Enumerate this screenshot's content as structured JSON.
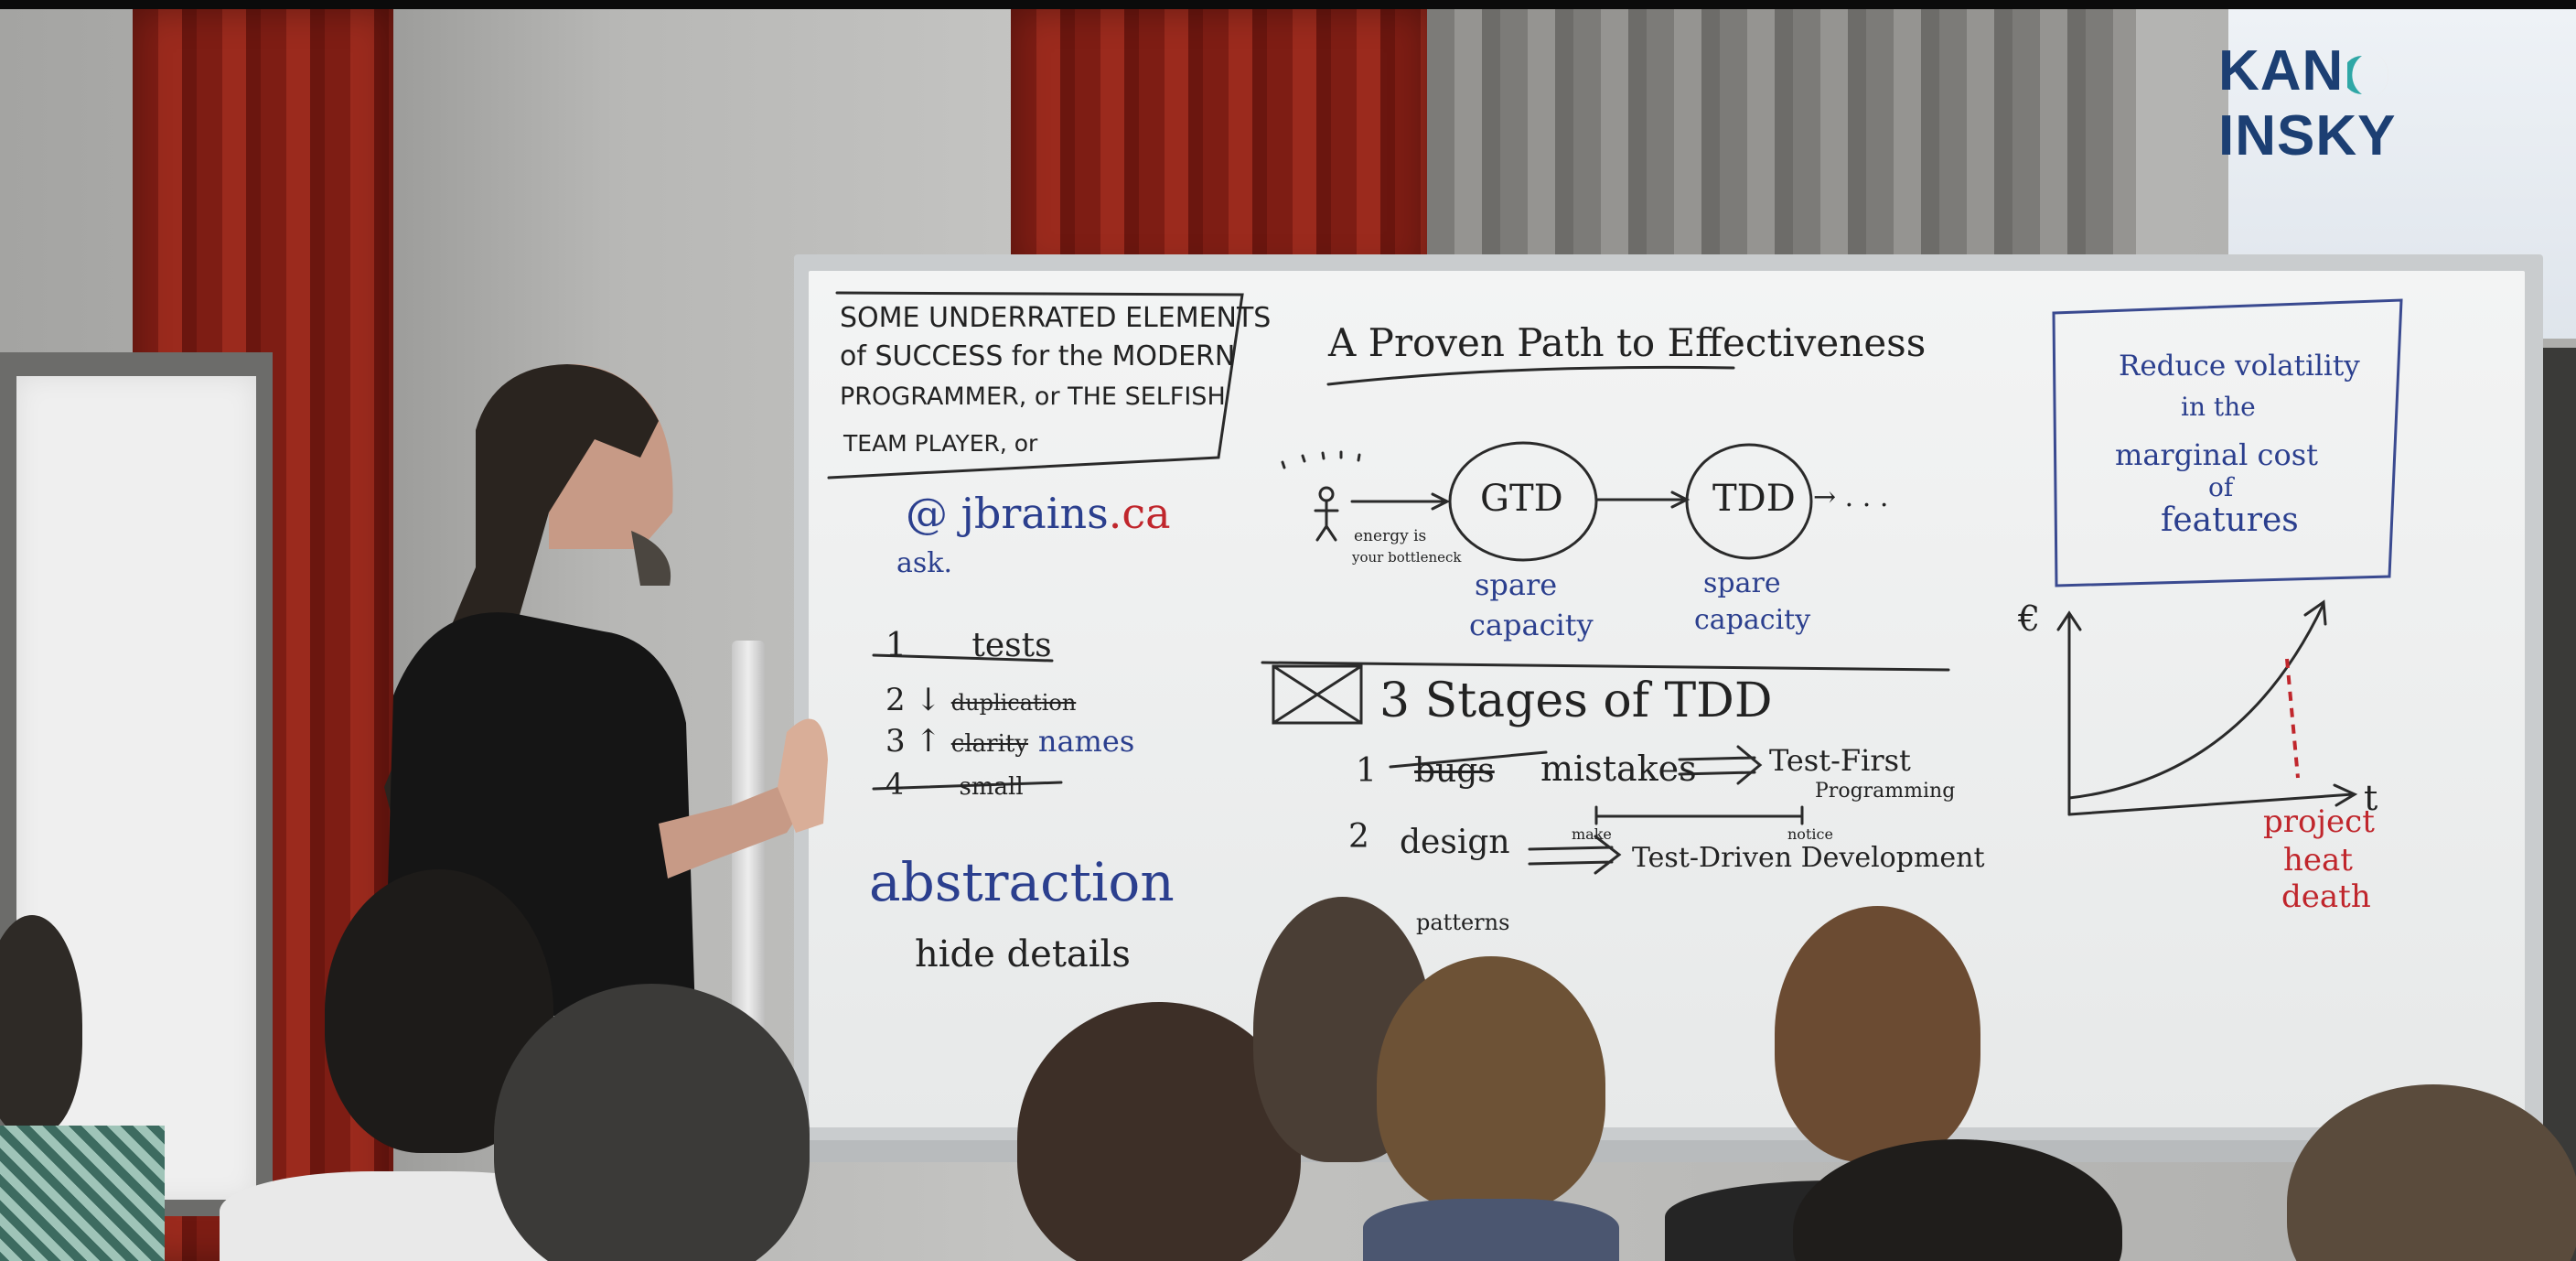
{
  "logo": {
    "text_left": "KAN",
    "text_right": "INSKY",
    "colors": {
      "text": "#1c3f73",
      "mark_orange": "#e8771c",
      "mark_teal": "#2fa7a6"
    }
  },
  "whiteboard": {
    "title_box": {
      "line1": "SOME UNDERRATED ELEMENTS",
      "line2": "of SUCCESS for the MODERN",
      "line3": "PROGRAMMER, or THE SELFISH",
      "line4": "TEAM PLAYER, or"
    },
    "handle": "@ jbrains.ca",
    "handle_at": "@",
    "handle_name": "jbrains",
    "handle_tld": ".ca",
    "ask": "ask.",
    "list": [
      {
        "num": "1",
        "text": "tests"
      },
      {
        "num": "2",
        "arrow": "↓",
        "text": "duplication"
      },
      {
        "num": "3",
        "arrow": "↑",
        "text": "clarity",
        "extra": "names"
      },
      {
        "num": "4",
        "text": "small"
      }
    ],
    "abstraction": "abstraction",
    "hide_details": "hide details",
    "path_title": "A Proven Path to Effectiveness",
    "path": {
      "node1": "GTD",
      "node2": "TDD",
      "trail": "→ . . .",
      "energy_note1": "energy is",
      "energy_note2": "your bottleneck",
      "spare1a": "spare",
      "spare1b": "capacity",
      "spare2a": "spare",
      "spare2b": "capacity"
    },
    "stages_title": "3 Stages of TDD",
    "stage1": {
      "num": "1",
      "struck": "bugs",
      "word": "mistakes",
      "result1": "Test-First",
      "result2": "Programming"
    },
    "stage2": {
      "num": "2",
      "word": "design",
      "note_make": "make",
      "note_notice": "notice",
      "result": "Test-Driven Development"
    },
    "patterns": "patterns",
    "volatility_box": {
      "line1": "Reduce volatility",
      "line2": "in the",
      "line3": "marginal cost",
      "line4": "of",
      "line5": "features"
    },
    "graph": {
      "y_label": "€",
      "x_label": "t",
      "note1": "project",
      "note2": "heat",
      "note3": "death"
    }
  }
}
